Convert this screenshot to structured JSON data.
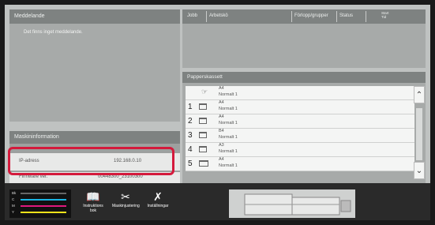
{
  "message_panel": {
    "title": "Meddelande",
    "text": "Det finns inget meddelande."
  },
  "machine_info": {
    "title": "Maskininformation",
    "ip_label": "IP-adress",
    "ip_value": "192.168.0.10",
    "fw_label": "Firmware ver.",
    "fw_value": "00448300_23100300"
  },
  "job_list": {
    "headers": [
      "Jobb",
      "Arbetskö",
      "Förlopp/grupper",
      "Status",
      "Start Tid"
    ]
  },
  "paper_tray": {
    "title": "Papperskassett",
    "rows": [
      {
        "number": "",
        "size": "A4",
        "type": "Normalt 1",
        "icon": "bypass-tray-icon"
      },
      {
        "number": "1",
        "size": "A4",
        "type": "Normalt 1",
        "icon": "tray-icon"
      },
      {
        "number": "2",
        "size": "A4",
        "type": "Normalt 1",
        "icon": "tray-icon"
      },
      {
        "number": "3",
        "size": "B4",
        "type": "Normalt 1",
        "icon": "tray-icon"
      },
      {
        "number": "4",
        "size": "A3",
        "type": "Normalt 1",
        "icon": "tray-icon"
      },
      {
        "number": "5",
        "size": "A4",
        "type": "Normalt 1",
        "icon": "tray-icon"
      }
    ]
  },
  "toner": {
    "labels": [
      "Bk",
      "C",
      "M",
      "Y"
    ],
    "colors": [
      "#000000",
      "#19b5e3",
      "#e0197d",
      "#f2e21a"
    ]
  },
  "nav": {
    "instructions": "Instruktions bok",
    "adjust": "Maskinjustering",
    "settings": "Inställningar"
  }
}
